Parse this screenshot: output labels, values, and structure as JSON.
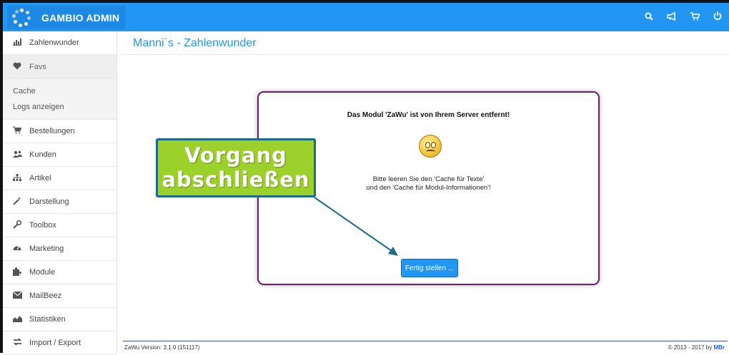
{
  "header": {
    "app_title": "GAMBIO ADMIN",
    "icons": [
      "search-icon",
      "megaphone-icon",
      "cart-icon",
      "power-icon"
    ]
  },
  "sidebar": {
    "items": [
      {
        "label": "Zahlenwunder",
        "icon": "chart-icon"
      },
      {
        "label": "Favs",
        "icon": "heart-icon"
      },
      {
        "label": "Bestellungen",
        "icon": "cart-icon"
      },
      {
        "label": "Kunden",
        "icon": "users-icon"
      },
      {
        "label": "Artikel",
        "icon": "sitemap-icon"
      },
      {
        "label": "Darstellung",
        "icon": "magic-wand-icon"
      },
      {
        "label": "Toolbox",
        "icon": "wrench-icon"
      },
      {
        "label": "Marketing",
        "icon": "dashboard-icon"
      },
      {
        "label": "Module",
        "icon": "puzzle-icon"
      },
      {
        "label": "MailBeez",
        "icon": "envelope-icon"
      },
      {
        "label": "Statistiken",
        "icon": "area-chart-icon"
      },
      {
        "label": "Import / Export",
        "icon": "exchange-icon"
      }
    ],
    "favs_sub": [
      "Cache",
      "Logs anzeigen"
    ]
  },
  "main": {
    "page_title": "Manni´s - Zahlenwunder"
  },
  "dialog": {
    "heading": "Das Modul 'ZaWu' ist von Ihrem Server entfernt!",
    "text_line1": "Bitte leeren Sie den 'Cache für Texte'",
    "text_line2": "und den 'Cache für Modul-Informationen'!",
    "button_label": "Fertig stellen ..."
  },
  "callout": {
    "line1": "Vorgang",
    "line2": "abschließen",
    "color": "#9bd12a"
  },
  "footer": {
    "version": "ZaWu Version: 3.1.0 (151117)",
    "copyright": "© 2013 - 2017 by",
    "author": "MBr"
  },
  "colors": {
    "primary": "#2196f3",
    "dialog_border": "#6a1e6a"
  }
}
